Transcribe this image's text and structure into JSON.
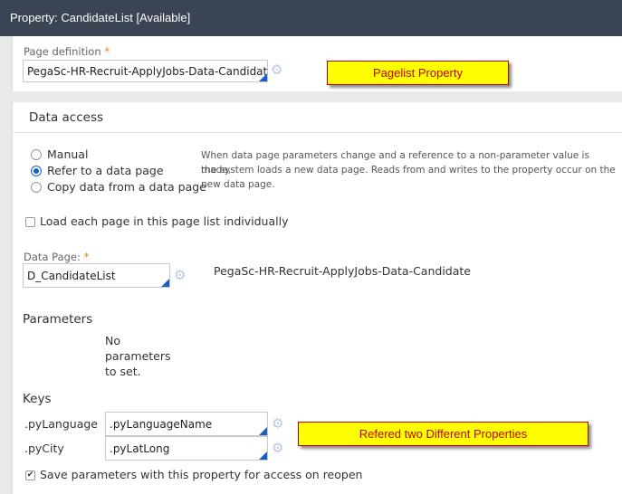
{
  "window": {
    "title": "Property: CandidateList [Available]"
  },
  "page_definition": {
    "label": "Page definition",
    "required_mark": "*",
    "value": "PegaSc-HR-Recruit-ApplyJobs-Data-Candidate"
  },
  "callouts": {
    "pagelist": "Pagelist Property",
    "refered": "Refered two Different Properties"
  },
  "data_access": {
    "heading": "Data access",
    "options": [
      "Manual",
      "Refer to a data page",
      "Copy data from a data page"
    ],
    "selected": "Refer to a data page",
    "help_lines": [
      "When data page parameters change and a reference to a non-parameter value is made,",
      "the system loads a new data page. Reads from and writes to the property occur on the",
      "new data page."
    ],
    "load_each_label": "Load each page in this page list individually",
    "load_each_checked": false
  },
  "data_page": {
    "label": "Data Page:",
    "required_mark": "*",
    "value": "D_CandidateList",
    "class_name": "PegaSc-HR-Recruit-ApplyJobs-Data-Candidate"
  },
  "parameters": {
    "heading": "Parameters",
    "empty_lines": [
      "No",
      "parameters",
      "to set."
    ]
  },
  "keys": {
    "heading": "Keys",
    "rows": [
      {
        "name": ".pyLanguage",
        "value": ".pyLanguageName"
      },
      {
        "name": ".pyCity",
        "value": ".pyLatLong"
      }
    ],
    "save_label": "Save parameters with this property for access on reopen",
    "save_checked": true
  },
  "icons": {
    "gear": "gear-icon",
    "checkmark": "checkmark-icon",
    "dropdown_corner": "dropdown-corner-icon"
  }
}
